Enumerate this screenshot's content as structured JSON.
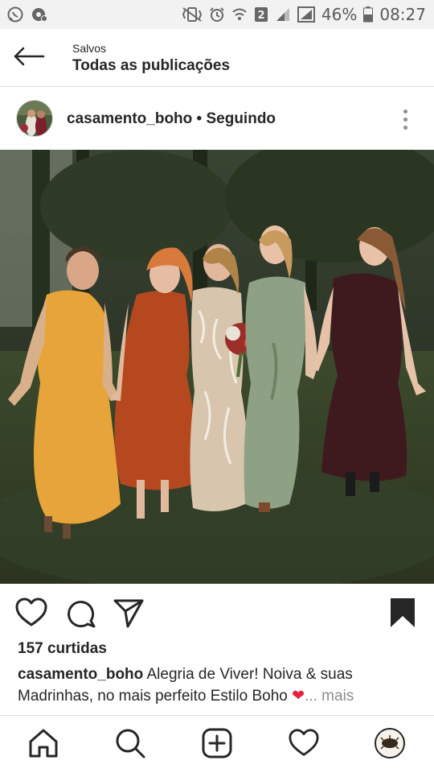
{
  "status_bar": {
    "battery": "46%",
    "time": "08:27",
    "icons": [
      "whatsapp-icon",
      "settings-icon",
      "vibrate-icon",
      "alarm-icon",
      "wifi-icon",
      "sim2-icon",
      "signal-icon",
      "signal-icon",
      "battery-icon"
    ]
  },
  "header": {
    "super_title": "Salvos",
    "title": "Todas as publicações",
    "back_icon": "arrow-left-icon"
  },
  "post": {
    "username": "casamento_boho",
    "separator": " • ",
    "follow_status": "Seguindo",
    "menu_icon": "more-vertical-icon",
    "likes": "157 curtidas",
    "caption_user": "casamento_boho",
    "caption_text": " Alegria de Viver! Noiva & suas Madrinhas, no mais perfeito Estilo Boho ",
    "caption_emoji": "❤",
    "caption_ellipsis": "... ",
    "caption_more": "mais",
    "actions": [
      "heart-icon",
      "comment-icon",
      "share-icon",
      "bookmark-icon"
    ],
    "dress_colors": [
      "#e6a43b",
      "#b5481f",
      "#d7c6ad",
      "#8fa184",
      "#3e1a1e"
    ]
  },
  "bottom_nav": {
    "items": [
      "home-icon",
      "search-icon",
      "add-icon",
      "activity-icon",
      "profile-avatar"
    ]
  },
  "colors": {
    "text": "#262626",
    "muted": "#8e8e8e",
    "border": "#dbdbdb",
    "status_bg": "#f2f2f2"
  }
}
